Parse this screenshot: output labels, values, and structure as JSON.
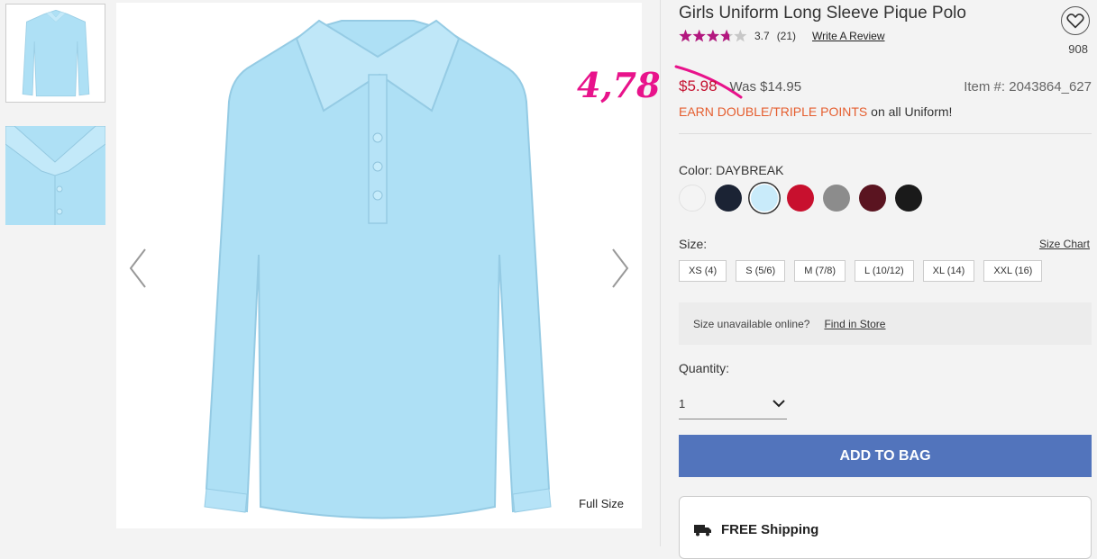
{
  "product": {
    "title": "Girls Uniform Long Sleeve Pique Polo",
    "rating_value": "3.7",
    "rating_count": "(21)",
    "rating_stars": 3.7,
    "write_review": "Write A Review",
    "favorites_count": "908",
    "sale_price": "$5.98",
    "was_price": "Was $14.95",
    "item_number": "Item #: 2043864_627",
    "points_highlight": "EARN DOUBLE/TRIPLE POINTS",
    "points_rest": " on all Uniform!"
  },
  "annotation": {
    "handwritten_price": "4,78",
    "color": "#e8138b"
  },
  "gallery": {
    "full_size_label": "Full Size",
    "shirt_color": "#aee0f5"
  },
  "color": {
    "label_prefix": "Color: ",
    "selected_name": "DAYBREAK",
    "swatches": [
      {
        "name": "white",
        "hex": "#f4f4f4"
      },
      {
        "name": "navy",
        "hex": "#1b2334"
      },
      {
        "name": "daybreak",
        "hex": "#c9ebfa",
        "selected": true
      },
      {
        "name": "red",
        "hex": "#c8102e"
      },
      {
        "name": "heather-gray",
        "hex": "#8c8c8c"
      },
      {
        "name": "burgundy",
        "hex": "#5a1420"
      },
      {
        "name": "black",
        "hex": "#1a1a1a"
      }
    ]
  },
  "size": {
    "label": "Size:",
    "chart_link": "Size Chart",
    "options": [
      "XS (4)",
      "S (5/6)",
      "M (7/8)",
      "L (10/12)",
      "XL (14)",
      "XXL (16)"
    ]
  },
  "availability": {
    "text": "Size unavailable online?",
    "link": "Find in Store"
  },
  "quantity": {
    "label": "Quantity:",
    "value": "1"
  },
  "cart": {
    "add_to_bag": "ADD TO BAG"
  },
  "shipping": {
    "label": "FREE Shipping"
  },
  "colors": {
    "accent": "#5274bc",
    "sale": "#c41230",
    "points": "#e55e2f",
    "stars": "#b3177f"
  }
}
